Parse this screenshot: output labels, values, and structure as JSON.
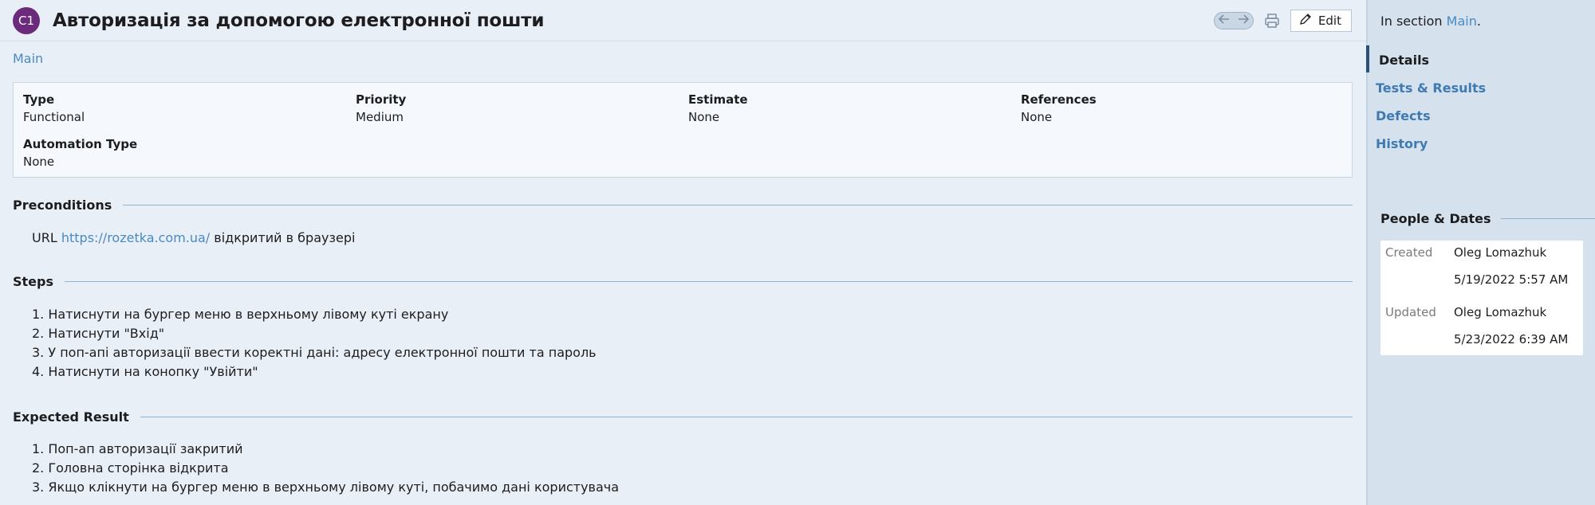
{
  "header": {
    "badge": "C1",
    "title": "Авторизація за допомогою електронної пошти",
    "edit_label": "Edit"
  },
  "breadcrumb": "Main",
  "fields": {
    "type_label": "Type",
    "type_value": "Functional",
    "priority_label": "Priority",
    "priority_value": "Medium",
    "estimate_label": "Estimate",
    "estimate_value": "None",
    "references_label": "References",
    "references_value": "None",
    "automation_label": "Automation Type",
    "automation_value": "None"
  },
  "preconditions": {
    "title": "Preconditions",
    "prefix": "URL",
    "link": "https://rozetka.com.ua/",
    "suffix": "відкритий в браузері"
  },
  "steps": {
    "title": "Steps",
    "items": [
      "1. Натиснути на бургер меню в верхньому лівому куті екрану",
      "2. Натиснути \"Вхід\"",
      "3. У поп-апі авторизації ввести коректні дані: адресу електронної пошти та пароль",
      "4. Натиснути на конопку \"Увійти\""
    ]
  },
  "expected": {
    "title": "Expected Result",
    "items": [
      "1. Поп-ап авторизації закритий",
      "2. Головна сторінка відкрита",
      "3. Якщо клікнути на бургер меню в верхньому лівому куті, побачимо дані користувача"
    ]
  },
  "sidebar": {
    "in_section_prefix": "In section",
    "in_section_link": "Main",
    "in_section_suffix": ".",
    "tabs": [
      "Details",
      "Tests & Results",
      "Defects",
      "History"
    ],
    "people_title": "People & Dates",
    "created_label": "Created",
    "created_by": "Oleg Lomazhuk",
    "created_date": "5/19/2022 5:57 AM",
    "updated_label": "Updated",
    "updated_by": "Oleg Lomazhuk",
    "updated_date": "5/23/2022 6:39 AM"
  },
  "icons": {
    "prev": "arrow-left-icon",
    "next": "arrow-right-icon",
    "print": "printer-icon",
    "edit": "pencil-icon"
  },
  "colors": {
    "accent": "#4a8ac2",
    "badge": "#6b2a7c",
    "sidebar_bg": "#d5e1ed"
  }
}
